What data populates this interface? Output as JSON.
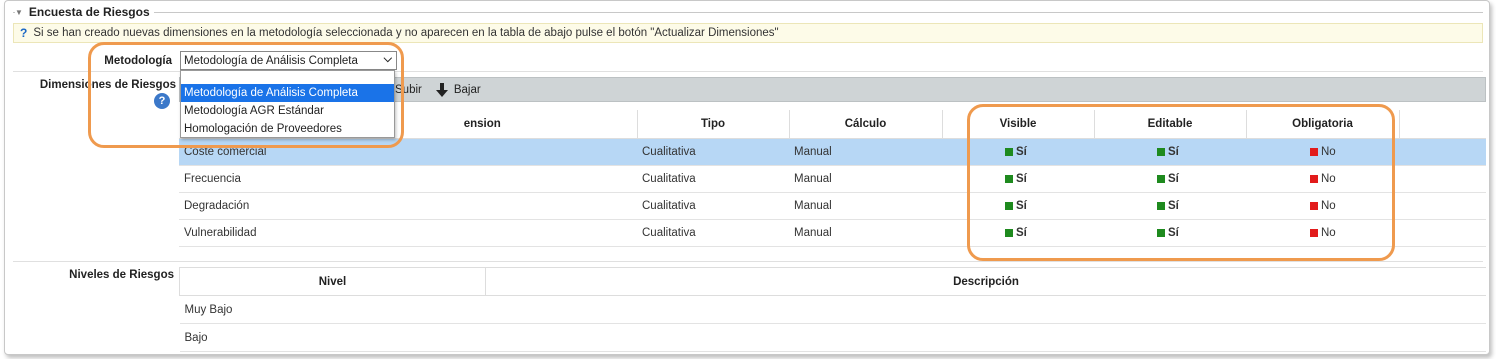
{
  "section": {
    "title": "Encuesta de Riesgos"
  },
  "info": {
    "icon": "?",
    "text": "Si se han creado nuevas dimensiones en la metodología seleccionada y no aparecen en la tabla de abajo pulse el botón \"Actualizar Dimensiones\""
  },
  "metodologia": {
    "label": "Metodología",
    "selected": "Metodología de Análisis Completa",
    "options": [
      "Metodología de Análisis Completa",
      "Metodología AGR Estándar",
      "Homologación de Proveedores"
    ]
  },
  "dimensiones": {
    "label": "Dimensiones de Riesgos",
    "help_icon": "?",
    "toolbar": {
      "subir": "Subir",
      "bajar": "Bajar"
    },
    "columns": [
      "Dimension",
      "Tipo",
      "Cálculo",
      "Visible",
      "Editable",
      "Obligatoria"
    ],
    "header_visible_text": "ension",
    "rows": [
      {
        "dimension": "Coste comercial",
        "tipo": "Cualitativa",
        "calculo": "Manual",
        "visible": "Sí",
        "editable": "Sí",
        "obligatoria": "No"
      },
      {
        "dimension": "Frecuencia",
        "tipo": "Cualitativa",
        "calculo": "Manual",
        "visible": "Sí",
        "editable": "Sí",
        "obligatoria": "No"
      },
      {
        "dimension": "Degradación",
        "tipo": "Cualitativa",
        "calculo": "Manual",
        "visible": "Sí",
        "editable": "Sí",
        "obligatoria": "No"
      },
      {
        "dimension": "Vulnerabilidad",
        "tipo": "Cualitativa",
        "calculo": "Manual",
        "visible": "Sí",
        "editable": "Sí",
        "obligatoria": "No"
      }
    ]
  },
  "niveles": {
    "label": "Niveles de Riesgos",
    "columns": [
      "Nivel",
      "Descripción"
    ],
    "rows": [
      {
        "nivel": "Muy Bajo",
        "descripcion": ""
      },
      {
        "nivel": "Bajo",
        "descripcion": ""
      }
    ]
  },
  "colors": {
    "yes": "#1e8a1e",
    "no": "#e21b1b",
    "selected_row": "#b7d7f5",
    "highlight": "#ef9a4e",
    "dropdown_selected": "#1a73e8"
  }
}
